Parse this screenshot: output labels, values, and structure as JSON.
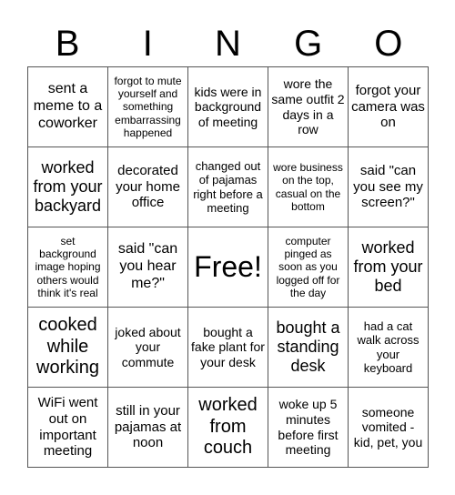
{
  "header": {
    "letters": [
      "B",
      "I",
      "N",
      "G",
      "O"
    ]
  },
  "board": {
    "cells": [
      "sent a meme to a coworker",
      "forgot to mute yourself and something embarrassing happened",
      "kids were in background of meeting",
      "wore the same outfit 2 days in a row",
      "forgot your camera was on",
      "worked from your backyard",
      "decorated your home office",
      "changed out of pajamas right before a meeting",
      "wore business on the top, casual on the bottom",
      "said \"can you see my screen?\"",
      "set background image hoping others would think it's real",
      "said \"can you hear me?\"",
      "Free!",
      "computer pinged as soon as you logged off for the day",
      "worked from your bed",
      "cooked while working",
      "joked about your commute",
      "bought a fake plant for your desk",
      "bought a standing desk",
      "had a cat walk across your keyboard",
      "WiFi went out on important meeting",
      "still in your pajamas at noon",
      "worked from couch",
      "woke up 5 minutes before first meeting",
      "someone vomited - kid, pet, you"
    ]
  }
}
